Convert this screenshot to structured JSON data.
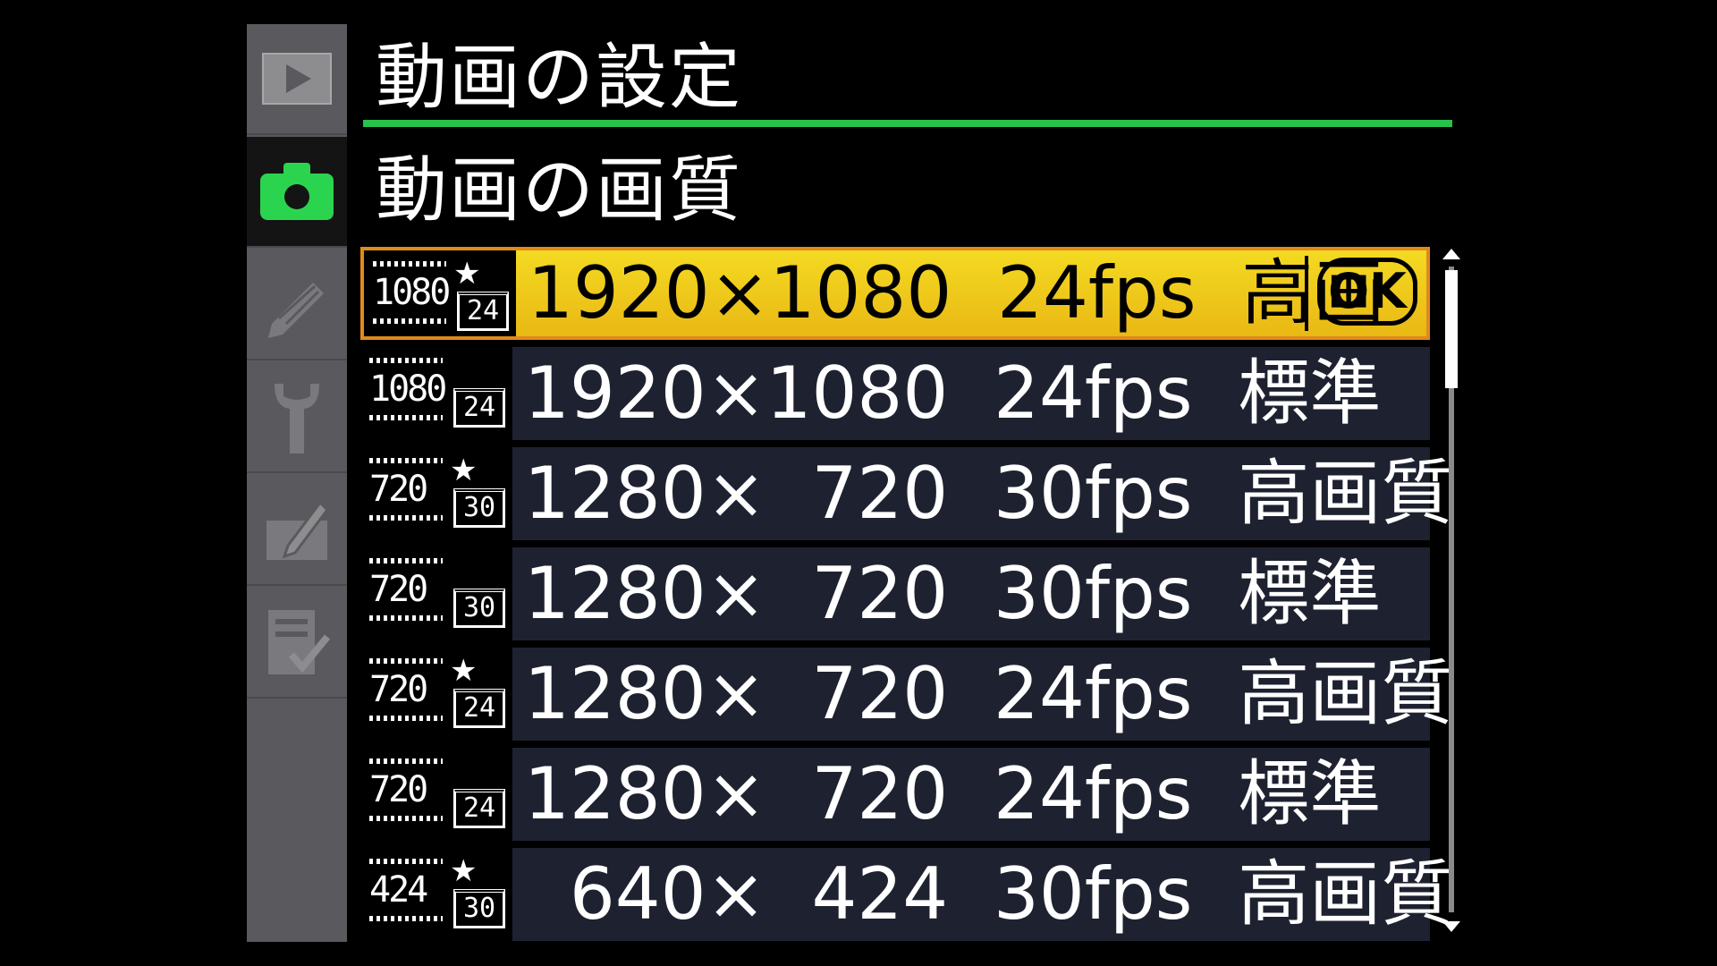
{
  "header": {
    "title": "動画の設定",
    "subtitle": "動画の画質"
  },
  "sidebar": {
    "tabs": [
      {
        "icon": "playback-icon",
        "active": false
      },
      {
        "icon": "camera-icon",
        "active": true
      },
      {
        "icon": "pencil-icon",
        "active": false
      },
      {
        "icon": "wrench-icon",
        "active": false
      },
      {
        "icon": "retouch-icon",
        "active": false
      },
      {
        "icon": "my-menu-icon",
        "active": false
      }
    ]
  },
  "options": [
    {
      "icon_res": "1080",
      "icon_fps": "24",
      "star": "★",
      "text": "1920×1080  24fps  高画",
      "selected": true
    },
    {
      "icon_res": "1080",
      "icon_fps": "24",
      "star": "",
      "text": "1920×1080  24fps  標準",
      "selected": false
    },
    {
      "icon_res": "720",
      "icon_fps": "30",
      "star": "★",
      "text": "1280×  720  30fps  高画質",
      "selected": false
    },
    {
      "icon_res": "720",
      "icon_fps": "30",
      "star": "",
      "text": "1280×  720  30fps  標準",
      "selected": false
    },
    {
      "icon_res": "720",
      "icon_fps": "24",
      "star": "★",
      "text": "1280×  720  24fps  高画質",
      "selected": false
    },
    {
      "icon_res": "720",
      "icon_fps": "24",
      "star": "",
      "text": "1280×  720  24fps  標準",
      "selected": false
    },
    {
      "icon_res": "424",
      "icon_fps": "30",
      "star": "★",
      "text": "  640×  424  30fps  高画質",
      "selected": false
    }
  ],
  "ok_label": "OK",
  "colors": {
    "accent_rule": "#26c24a",
    "selected_row": "#f4da22",
    "selected_border": "#e08a1c",
    "row_bg": "#1e2230",
    "active_tab_icon": "#2bd44e"
  }
}
